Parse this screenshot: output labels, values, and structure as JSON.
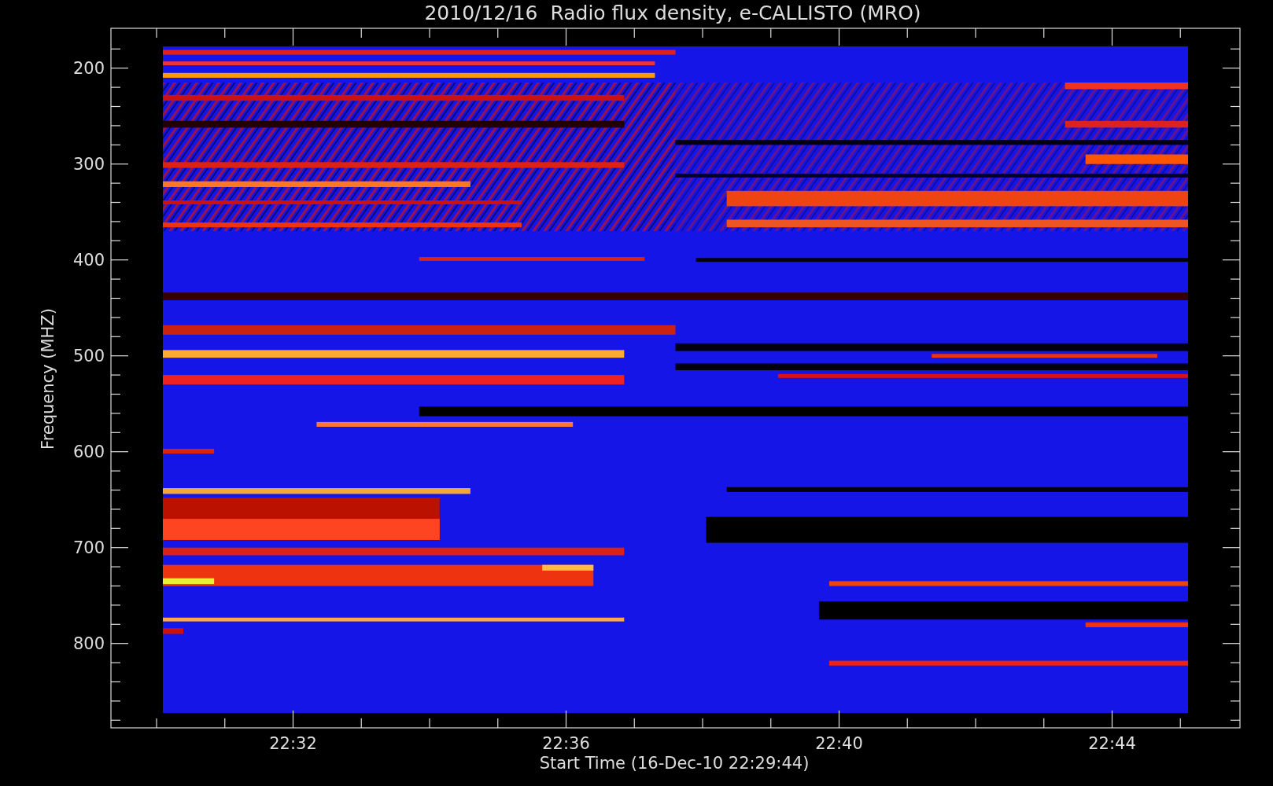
{
  "title": "2010/12/16  Radio flux density, e-CALLISTO (MRO)",
  "y_axis": {
    "label": "Frequency (MHZ)",
    "ticks": [
      "200",
      "300",
      "400",
      "500",
      "600",
      "700",
      "800"
    ]
  },
  "x_axis": {
    "label": "Start Time (16-Dec-10 22:29:44)",
    "ticks": [
      "22:32",
      "22:36",
      "22:40",
      "22:44"
    ]
  }
}
